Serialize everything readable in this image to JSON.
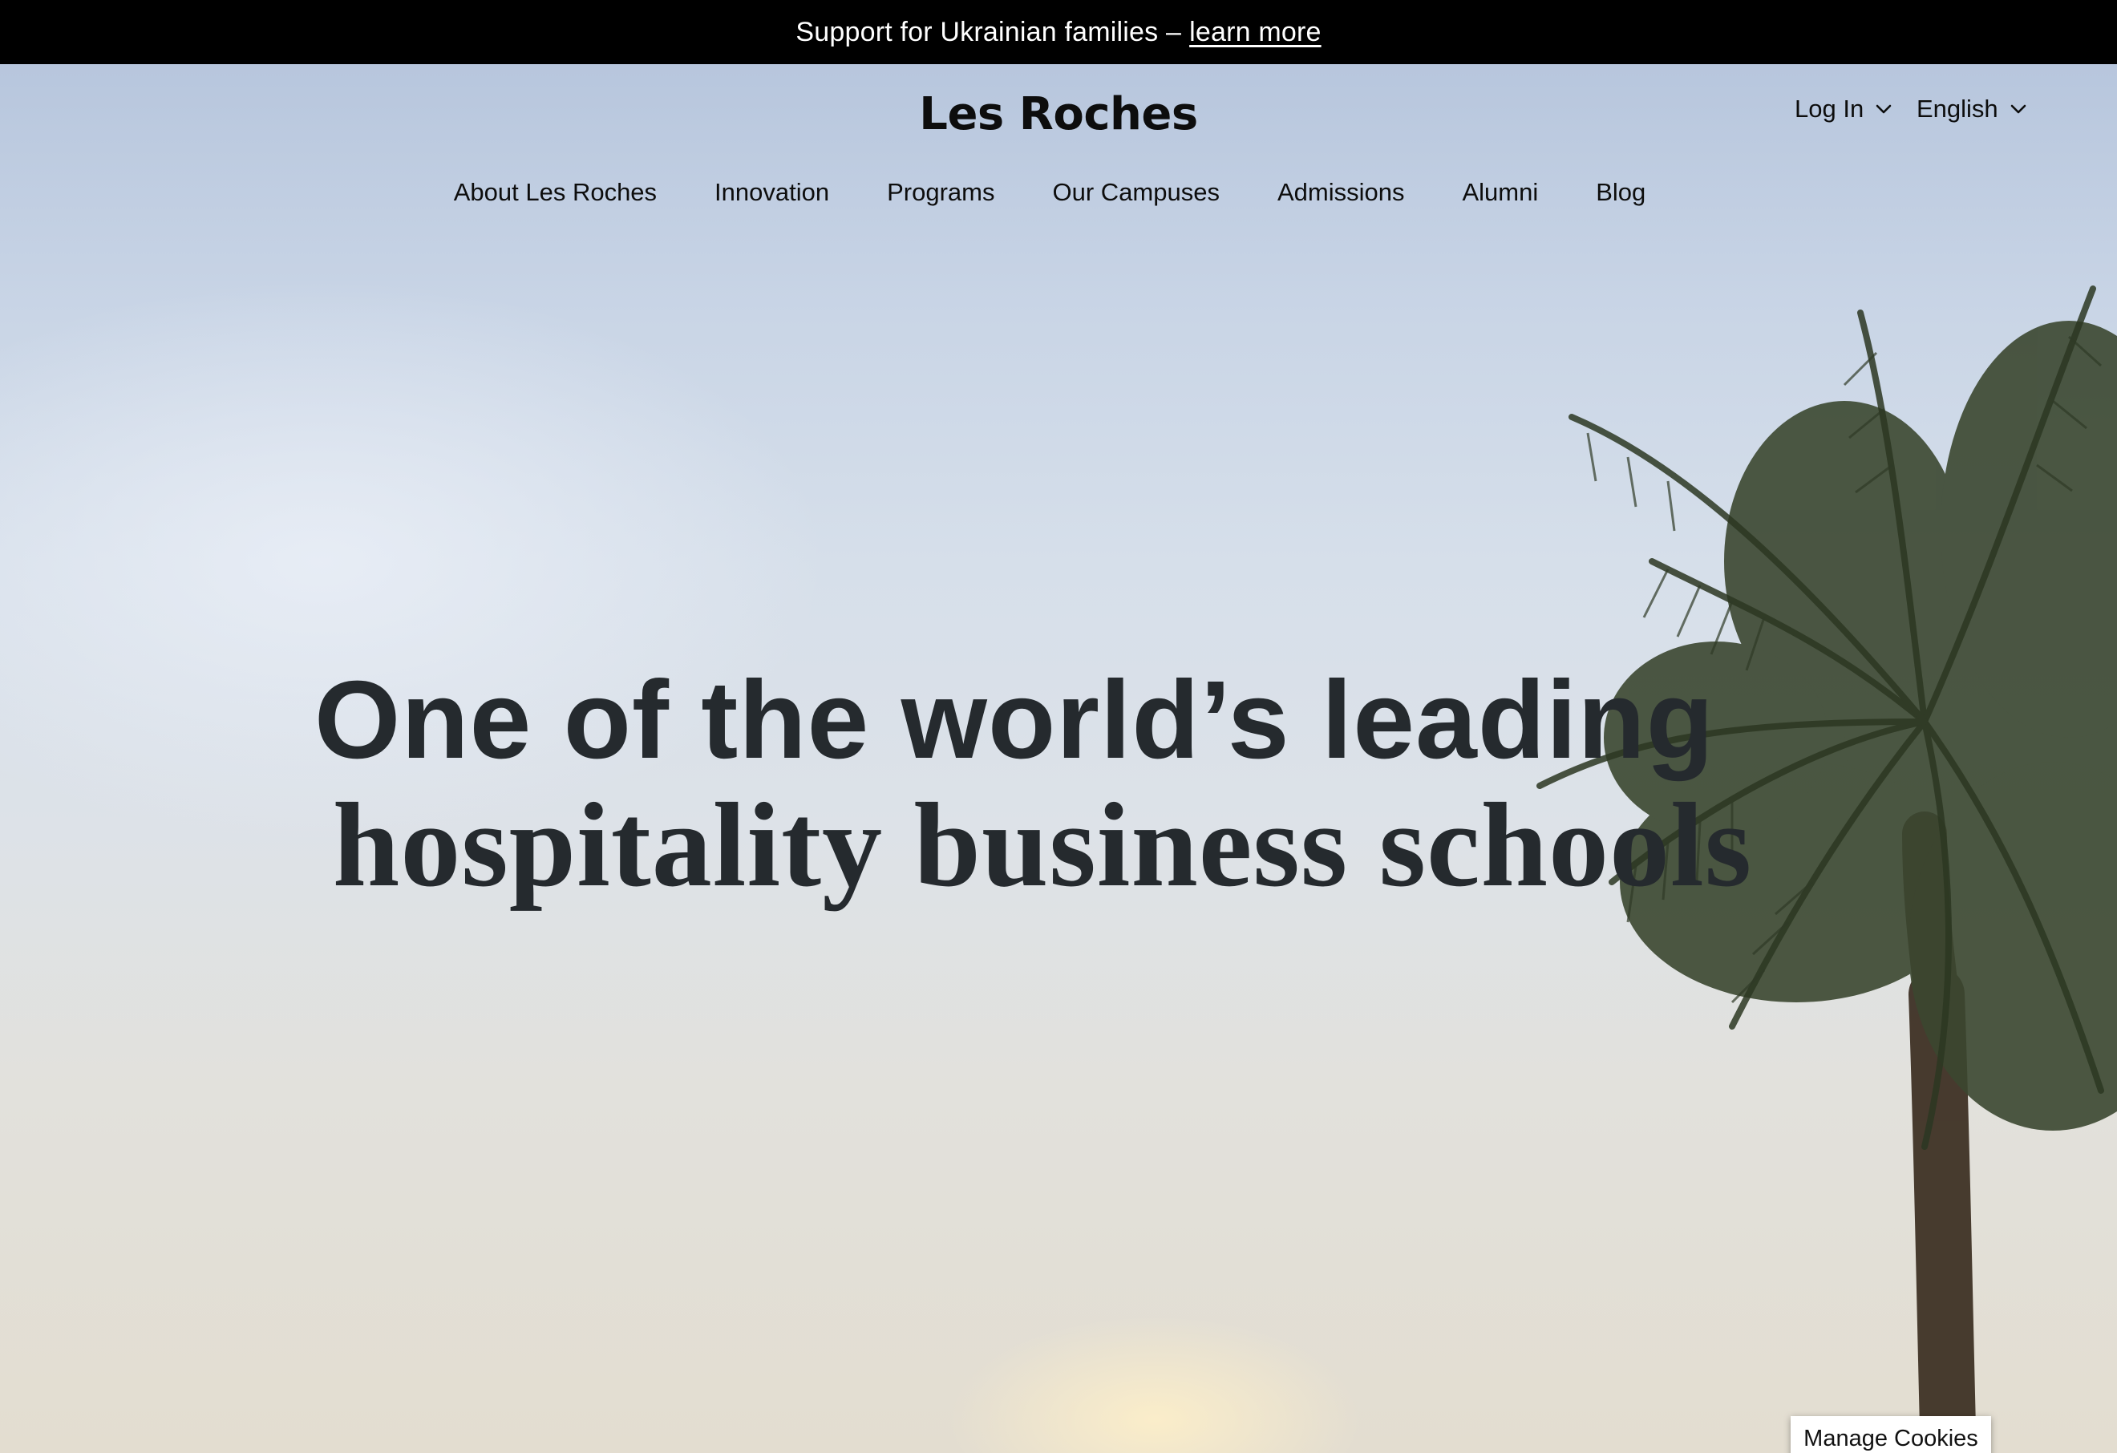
{
  "announcement": {
    "text": "Support for Ukrainian families –",
    "link": "learn more"
  },
  "header": {
    "logo": "Les Roches",
    "login": "Log In",
    "language": "English"
  },
  "nav": {
    "items": [
      {
        "label": "About Les Roches"
      },
      {
        "label": "Innovation"
      },
      {
        "label": "Programs"
      },
      {
        "label": "Our Campuses"
      },
      {
        "label": "Admissions"
      },
      {
        "label": "Alumni"
      },
      {
        "label": "Blog"
      }
    ]
  },
  "hero": {
    "headline_line1": "One of the world’s leading",
    "headline_line2": "hospitality business schools",
    "background": "palm-tree-sky-video"
  },
  "cookies": {
    "button": "Manage Cookies"
  },
  "colors": {
    "announcement_bg": "#000000",
    "headline": "#252a2e",
    "text": "#0d0d0d"
  }
}
